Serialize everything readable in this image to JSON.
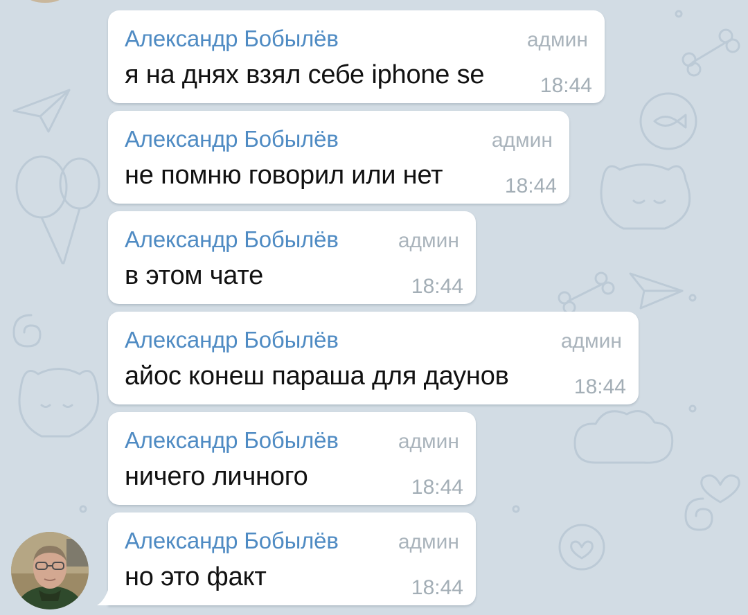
{
  "colors": {
    "background": "#d2dce4",
    "bubble": "#ffffff",
    "sender_name": "#4f8bc3",
    "role_badge": "#aab4bc",
    "message_text": "#111111",
    "timestamp": "#a3aeb6"
  },
  "icons": [
    "paper-plane-icon",
    "cat-icon",
    "bone-icon",
    "balloon-icon",
    "heart-icon",
    "fish-icon",
    "spiral-icon",
    "cloud-icon"
  ],
  "messages": [
    {
      "sender": "Александр Бобылёв",
      "role": "админ",
      "text": "я на днях взял себе iphone se",
      "time": "18:44"
    },
    {
      "sender": "Александр Бобылёв",
      "role": "админ",
      "text": "не помню говорил или нет",
      "time": "18:44"
    },
    {
      "sender": "Александр Бобылёв",
      "role": "админ",
      "text": "в этом чате",
      "time": "18:44"
    },
    {
      "sender": "Александр Бобылёв",
      "role": "админ",
      "text": "айос конеш параша для даунов",
      "time": "18:44"
    },
    {
      "sender": "Александр Бобылёв",
      "role": "админ",
      "text": "ничего личного",
      "time": "18:44"
    },
    {
      "sender": "Александр Бобылёв",
      "role": "админ",
      "text": "но это факт",
      "time": "18:44"
    }
  ]
}
